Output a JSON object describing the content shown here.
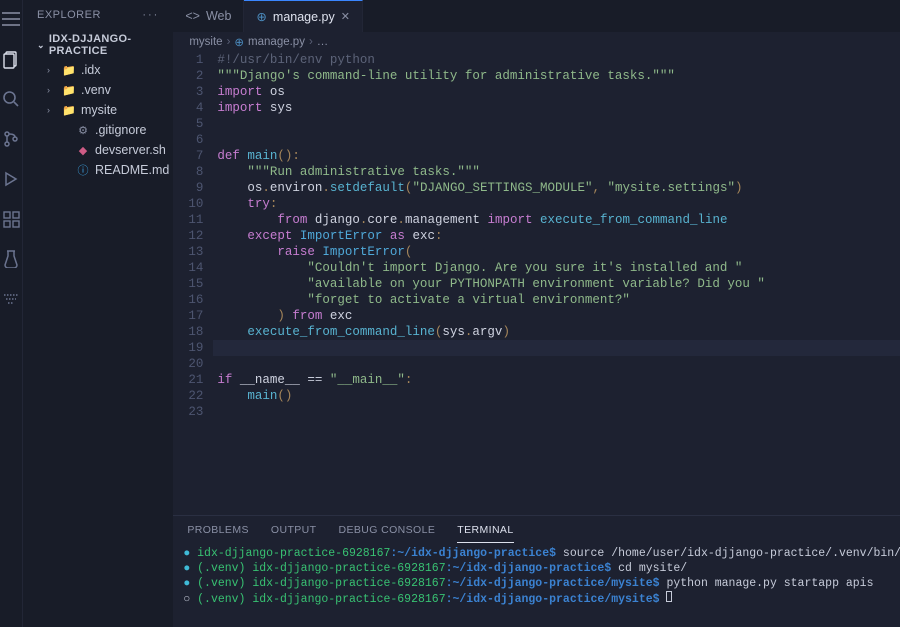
{
  "sidebar": {
    "title": "EXPLORER",
    "workspace": "IDX-DJJANGO-PRACTICE",
    "tree": [
      {
        "label": ".idx",
        "icon": "folder-gray",
        "chevron": "›",
        "indent": 1
      },
      {
        "label": ".venv",
        "icon": "folder-gray",
        "chevron": "›",
        "indent": 1
      },
      {
        "label": "mysite",
        "icon": "folder-orange",
        "chevron": "›",
        "indent": 1
      },
      {
        "label": ".gitignore",
        "icon": "gear",
        "chevron": "",
        "indent": 2
      },
      {
        "label": "devserver.sh",
        "icon": "shell",
        "chevron": "",
        "indent": 2
      },
      {
        "label": "README.md",
        "icon": "info",
        "chevron": "",
        "indent": 2
      }
    ]
  },
  "tabs": [
    {
      "label": "Web",
      "icon": "code",
      "active": false,
      "closable": false
    },
    {
      "label": "manage.py",
      "icon": "python",
      "active": true,
      "closable": true
    }
  ],
  "breadcrumb": [
    "mysite",
    "manage.py",
    "…"
  ],
  "code_lines": [
    "#!/usr/bin/env python",
    "\"\"\"Django's command-line utility for administrative tasks.\"\"\"",
    "import os",
    "import sys",
    "",
    "",
    "def main():",
    "    \"\"\"Run administrative tasks.\"\"\"",
    "    os.environ.setdefault(\"DJANGO_SETTINGS_MODULE\", \"mysite.settings\")",
    "    try:",
    "        from django.core.management import execute_from_command_line",
    "    except ImportError as exc:",
    "        raise ImportError(",
    "            \"Couldn't import Django. Are you sure it's installed and \"",
    "            \"available on your PYTHONPATH environment variable? Did you \"",
    "            \"forget to activate a virtual environment?\"",
    "        ) from exc",
    "    execute_from_command_line(sys.argv)",
    "",
    "",
    "if __name__ == \"__main__\":",
    "    main()",
    ""
  ],
  "highlight_line": 19,
  "panel": {
    "tabs": [
      "PROBLEMS",
      "OUTPUT",
      "DEBUG CONSOLE",
      "TERMINAL"
    ],
    "active_tab": 3,
    "terminal_lines": [
      {
        "bullet": "cyan",
        "venv": "",
        "host": "idx-djjango-practice-6928167",
        "path": "~/idx-djjango-practice",
        "cmd": "source /home/user/idx-djjango-practice/.venv/bin/activate"
      },
      {
        "bullet": "cyan",
        "venv": "(.venv) ",
        "host": "idx-djjango-practice-6928167",
        "path": "~/idx-djjango-practice",
        "cmd": "cd mysite/"
      },
      {
        "bullet": "cyan",
        "venv": "(.venv) ",
        "host": "idx-djjango-practice-6928167",
        "path": "~/idx-djjango-practice/mysite",
        "cmd": "python manage.py startapp apis"
      },
      {
        "bullet": "white",
        "venv": "(.venv) ",
        "host": "idx-djjango-practice-6928167",
        "path": "~/idx-djjango-practice/mysite",
        "cmd": "",
        "cursor": true
      }
    ]
  }
}
